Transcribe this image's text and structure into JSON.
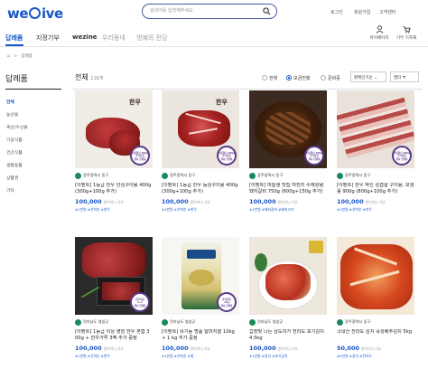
{
  "header": {
    "logo_text": "weGive",
    "search_placeholder": "검색어를 입력해주세요.",
    "top_links": [
      "로그인",
      "회원가입",
      "고객센터"
    ],
    "icons": [
      {
        "name": "user-icon",
        "label": "마이페이지"
      },
      {
        "name": "cart-icon",
        "label": "기부 기자재"
      }
    ]
  },
  "nav": {
    "items": [
      "답례품",
      "지정기부",
      "wezine",
      "우리동네",
      "명예의 전당"
    ]
  },
  "breadcrumb": {
    "home": "⌂",
    "sep": ">",
    "current": "답례품"
  },
  "sidebar": {
    "title": "답례품",
    "items": [
      "전체",
      "농산물",
      "축산/수산물",
      "가공식품",
      "건강식품",
      "생활용품",
      "상품권",
      "기타"
    ]
  },
  "toolbar": {
    "total_label": "전체",
    "total_count": "116개",
    "filters": [
      "전체",
      "모금진행",
      "준비중"
    ],
    "sort": "판매인기순",
    "view": "필터"
  },
  "products": [
    {
      "seller": "광주광역시 동구",
      "name": "[이벤트] 1등급 한우 안심구이용 400g (300g+100g 추가)",
      "price": "100,000",
      "price_note": "원이어니 기부",
      "tags": "#1만원 #선착순 #한우",
      "badge": "산림청인 100g\n추가증정\n행사 진행중"
    },
    {
      "seller": "광주광역시 동구",
      "name": "[이벤트] 1등급 한우 등심구이용 400g (300g+100g 추가)",
      "price": "100,000",
      "price_note": "원이어니 기부",
      "tags": "#1만원 #선착순 #한우",
      "badge": "산림청인 100g\n추가증정\n행사 진행중"
    },
    {
      "seller": "광주광역시 동구",
      "name": "[이벤트] 마늘생 맛집 여전지 수제양념 돼지갈비 750g (600g+150g 추가)",
      "price": "100,000",
      "price_note": "원이어니 기부",
      "tags": "#1만원 #돼지갈비 #돼지고기",
      "badge": "산림청인 150g\n추가증정\n행사 진행중"
    },
    {
      "seller": "광주광역시 동구",
      "name": "[이벤트] 한우 박인 삼겹살 구이용, 보쌈용 900g (800g+100g 추가)",
      "price": "100,000",
      "price_note": "원이어니 기부",
      "tags": "#1만원 #선착순 #한우",
      "badge": "산림청인 100g\n추가증정\n행사 진행중"
    },
    {
      "seller": "전라남도 영암군",
      "name": "[이벤트] 1등급 이상 영암 한우 혼합 3 00g + 한우가루 3팩 추가 증정",
      "price": "100,000",
      "price_note": "원이어니 기부",
      "tags": "#1만원 #선착순 #한우",
      "badge": "한우사골\n1+1\n행사 진행중"
    },
    {
      "seller": "전라남도 영암군",
      "name": "[이벤트] 유기농 명품 달마지쌀 10kg + 1 kg 추가 증정",
      "price": "100,000",
      "price_note": "원이어니 기부",
      "tags": "#1만원 #선착순 #쌀",
      "badge": "추가증정\n1kg\n행사 진행중"
    },
    {
      "seller": "전라남도 영암군",
      "name": "갑장맞 나는 남도미가 전라도 포기김치 4.5kg",
      "price": "100,000",
      "price_note": "원이어니 기부",
      "tags": "#1만원 #김치 #포기김치",
      "badge": ""
    },
    {
      "seller": "광주광역시 동구",
      "name": "국내산 전라도 김치 숙성배추김치 5kg",
      "price": "50,000",
      "price_note": "원이어니 기부",
      "tags": "#5만원 #김치 #전라도",
      "badge": ""
    }
  ]
}
